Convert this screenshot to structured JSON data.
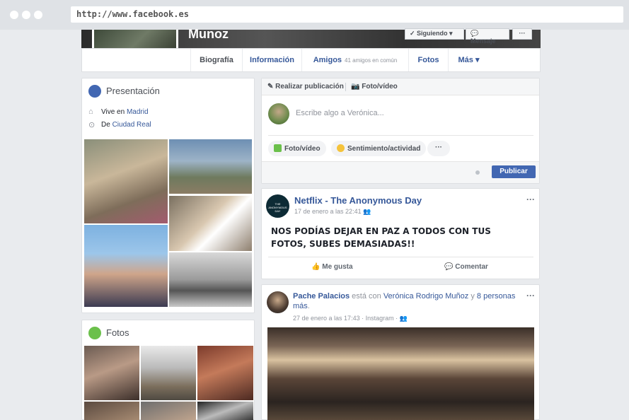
{
  "browser": {
    "url": "http://www.facebook.es"
  },
  "profile": {
    "name": "Munoz",
    "buttons": {
      "follow": "✓ Siguiendo ▾",
      "message": "Mensaje",
      "more": "···"
    },
    "nav": {
      "biografia": "Biografía",
      "informacion": "Información",
      "amigos": "Amigos",
      "amigos_sub": "41 amigos en común",
      "fotos": "Fotos",
      "mas": "Más ▾"
    }
  },
  "intro": {
    "title": "Presentación",
    "lives_prefix": "Vive en ",
    "lives_city": "Madrid",
    "from_prefix": "De ",
    "from_city": "Ciudad Real"
  },
  "photos_section": {
    "title": "Fotos"
  },
  "composer": {
    "tab_post": "Realizar publicación",
    "tab_photo": "Foto/vídeo",
    "placeholder": "Escribe algo a Verónica...",
    "pill_photo": "Foto/vídeo",
    "pill_feeling": "Sentimiento/actividad",
    "pill_more": "···",
    "publish": "Publicar"
  },
  "post1": {
    "author": "Netflix - The Anonymous Day",
    "avatar_text": "THE ANONYMOUS DAY",
    "time": "17 de enero a las 22:41",
    "text": "NOS PODÍAS DEJAR EN PAZ A TODOS CON TUS FOTOS, SUBES DEMASIADAS!!",
    "like": "Me gusta",
    "comment": "Comentar",
    "menu": "···"
  },
  "post2": {
    "author": "Pache Palacios",
    "with_text": " está con ",
    "tagged": "Verónica Rodrigo Muñoz",
    "and_text": " y ",
    "others": "8 personas más",
    "period": ".",
    "time": "27 de enero a las 17:43 · Instagram ·",
    "menu": "···"
  },
  "colors": {
    "brand": "#4267b2",
    "link": "#365899",
    "bg": "#e9ebee"
  }
}
